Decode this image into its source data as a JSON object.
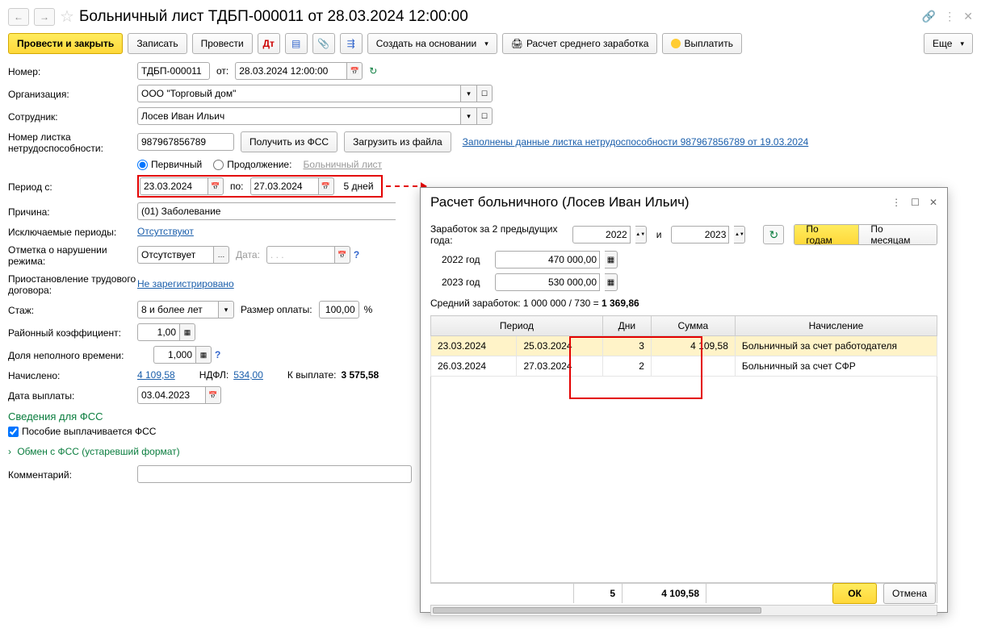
{
  "titlebar": {
    "title": "Больничный лист ТДБП-000011 от 28.03.2024 12:00:00"
  },
  "toolbar": {
    "post_close": "Провести и закрыть",
    "save": "Записать",
    "post": "Провести",
    "create_based": "Создать на основании",
    "avg_calc": "Расчет среднего заработка",
    "pay": "Выплатить",
    "more": "Еще"
  },
  "number": {
    "label": "Номер:",
    "value": "ТДБП-000011",
    "from": "от:",
    "date": "28.03.2024 12:00:00"
  },
  "org": {
    "label": "Организация:",
    "value": "ООО \"Торговый дом\""
  },
  "emp": {
    "label": "Сотрудник:",
    "value": "Лосев Иван Ильич"
  },
  "sheet": {
    "label": "Номер листка нетрудоспособности:",
    "value": "987967856789",
    "get_fss": "Получить из ФСС",
    "load_file": "Загрузить из файла",
    "filled_link": "Заполнены данные листка нетрудоспособности 987967856789 от 19.03.2024"
  },
  "type": {
    "primary": "Первичный",
    "continuation": "Продолжение:",
    "cont_link": "Больничный лист"
  },
  "period": {
    "label": "Период с:",
    "from": "23.03.2024",
    "to_lbl": "по:",
    "to": "27.03.2024",
    "days": "5 дней"
  },
  "reason": {
    "label": "Причина:",
    "value": "(01) Заболевание"
  },
  "exclude": {
    "label": "Исключаемые периоды:",
    "link": "Отсутствуют"
  },
  "violation": {
    "label": "Отметка о нарушении режима:",
    "value": "Отсутствует",
    "date_lbl": "Дата:",
    "date_ph": ". . ."
  },
  "suspend": {
    "label": "Приостановление трудового договора:",
    "link": "Не зарегистрировано"
  },
  "stage": {
    "label": "Стаж:",
    "value": "8 и более лет",
    "rate_lbl": "Размер оплаты:",
    "rate": "100,00",
    "pct": "%"
  },
  "district": {
    "label": "Районный коэффициент:",
    "value": "1,00"
  },
  "parttime": {
    "label": "Доля неполного времени:",
    "value": "1,000"
  },
  "accr": {
    "label": "Начислено:",
    "amount": "4 109,58",
    "ndfl_lbl": "НДФЛ:",
    "ndfl": "534,00",
    "payout_lbl": "К выплате:",
    "payout": "3 575,58"
  },
  "paydate": {
    "label": "Дата выплаты:",
    "value": "03.04.2023"
  },
  "fss": {
    "title": "Сведения для ФСС",
    "chk": "Пособие выплачивается ФСС",
    "exchange": "Обмен с ФСС (устаревший формат)"
  },
  "comment": {
    "label": "Комментарий:"
  },
  "popup": {
    "title": "Расчет больничного (Лосев Иван Ильич)",
    "earn_lbl": "Заработок за 2 предыдущих года:",
    "y1": "2022",
    "and": "и",
    "y2": "2023",
    "by_years": "По годам",
    "by_months": "По месяцам",
    "row1": {
      "y": "2022 год",
      "v": "470 000,00"
    },
    "row2": {
      "y": "2023 год",
      "v": "530 000,00"
    },
    "avg_pre": "Средний заработок: 1 000 000 / 730 = ",
    "avg_val": "1 369,86",
    "th_period": "Период",
    "th_days": "Дни",
    "th_sum": "Сумма",
    "th_accr": "Начисление",
    "r1": {
      "d1": "23.03.2024",
      "d2": "25.03.2024",
      "days": "3",
      "sum": "4 109,58",
      "name": "Больничный за счет работодателя"
    },
    "r2": {
      "d1": "26.03.2024",
      "d2": "27.03.2024",
      "days": "2",
      "sum": "",
      "name": "Больничный за счет СФР"
    },
    "tot_days": "5",
    "tot_sum": "4 109,58",
    "ok": "ОК",
    "cancel": "Отмена"
  }
}
